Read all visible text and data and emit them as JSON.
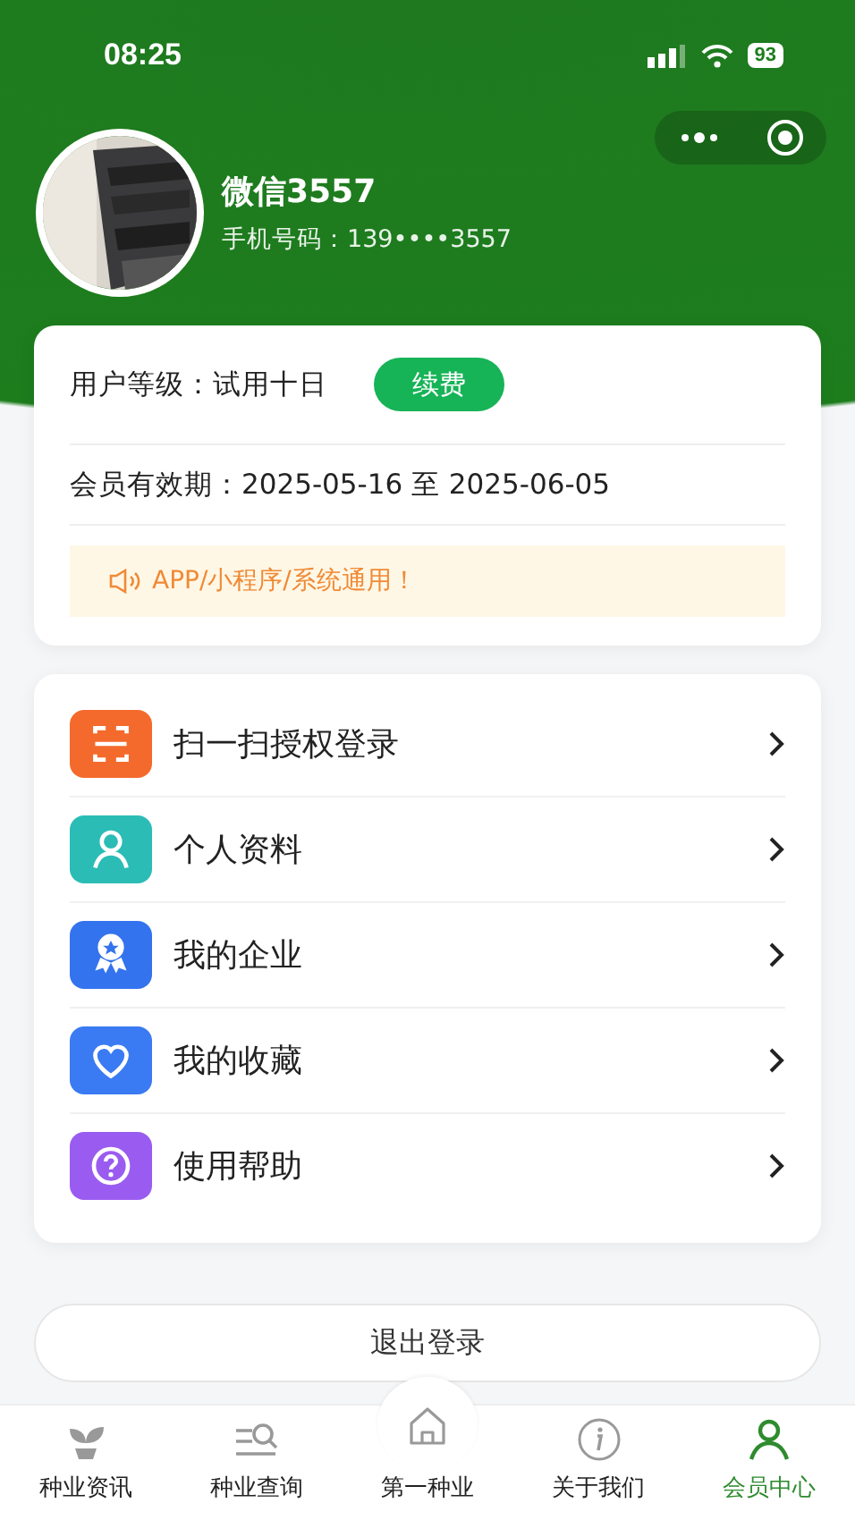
{
  "status_bar": {
    "time": "08:25",
    "battery": "93"
  },
  "profile": {
    "name": "微信3557",
    "phone": "手机号码：139••••3557"
  },
  "membership": {
    "level_label": "用户等级：",
    "level_value": "试用十日",
    "renew_button": "续费",
    "validity_label": "会员有效期：",
    "validity_value": "2025-05-16 至 2025-06-05",
    "notice": "APP/小程序/系统通用！"
  },
  "menu": [
    {
      "label": "扫一扫授权登录",
      "kind": "scan",
      "color": "#f46a2c"
    },
    {
      "label": "个人资料",
      "kind": "person",
      "color": "#2bbcb6"
    },
    {
      "label": "我的企业",
      "kind": "badge",
      "color": "#3473ee"
    },
    {
      "label": "我的收藏",
      "kind": "heart",
      "color": "#3a7af2"
    },
    {
      "label": "使用帮助",
      "kind": "help",
      "color": "#9a5cf0"
    }
  ],
  "logout_button": "退出登录",
  "tab_bar": [
    {
      "label": "种业资讯",
      "kind": "sprout",
      "selected": false
    },
    {
      "label": "种业查询",
      "kind": "search",
      "selected": false
    },
    {
      "label": "第一种业",
      "kind": "home",
      "selected": false
    },
    {
      "label": "关于我们",
      "kind": "info",
      "selected": false
    },
    {
      "label": "会员中心",
      "kind": "person",
      "selected": true
    }
  ]
}
